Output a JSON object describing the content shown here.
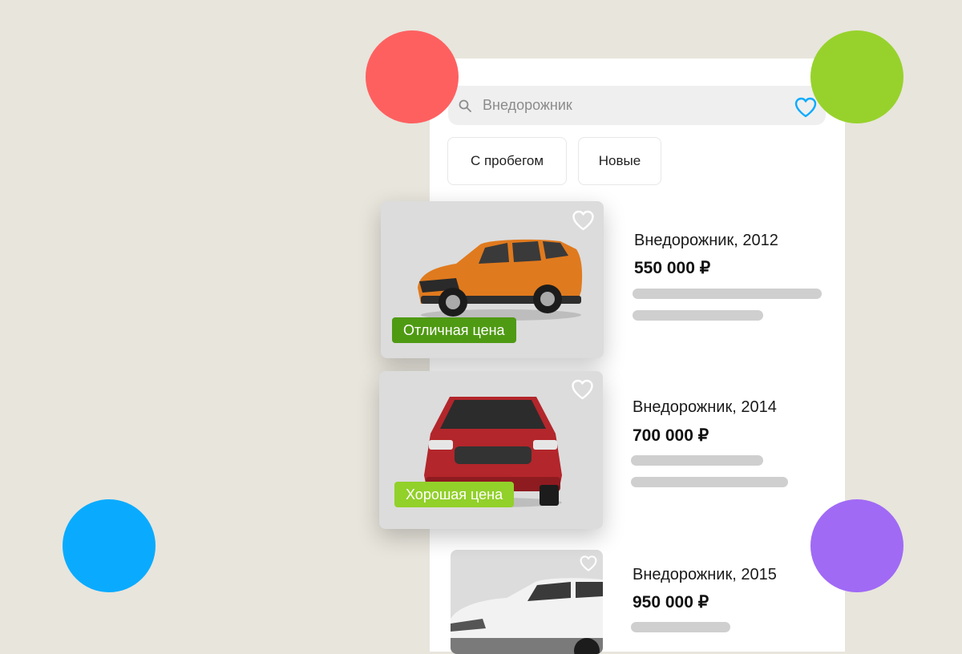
{
  "search": {
    "text": "Внедорожник"
  },
  "filters": [
    "С пробегом",
    "Новые"
  ],
  "listings": [
    {
      "title": "Внедорожник, 2012",
      "price": "550 000 ₽",
      "badge": "Отличная цена",
      "car_color": "#e07a1e"
    },
    {
      "title": "Внедорожник, 2014",
      "price": "700 000 ₽",
      "badge": "Хорошая цена",
      "car_color": "#b3262b"
    },
    {
      "title": "Внедорожник, 2015",
      "price": "950 000 ₽",
      "car_color": "#f2f2f2"
    }
  ],
  "colors": {
    "background": "#e8e5dc",
    "badge_excellent": "#4f9a13",
    "badge_good": "#92d02a",
    "heart_accent": "#0aabff",
    "dot_red": "#fe6060",
    "dot_green": "#97d22c",
    "dot_blue": "#0aabff",
    "dot_purple": "#a06af5"
  },
  "icons": [
    "search-icon",
    "heart-icon"
  ]
}
